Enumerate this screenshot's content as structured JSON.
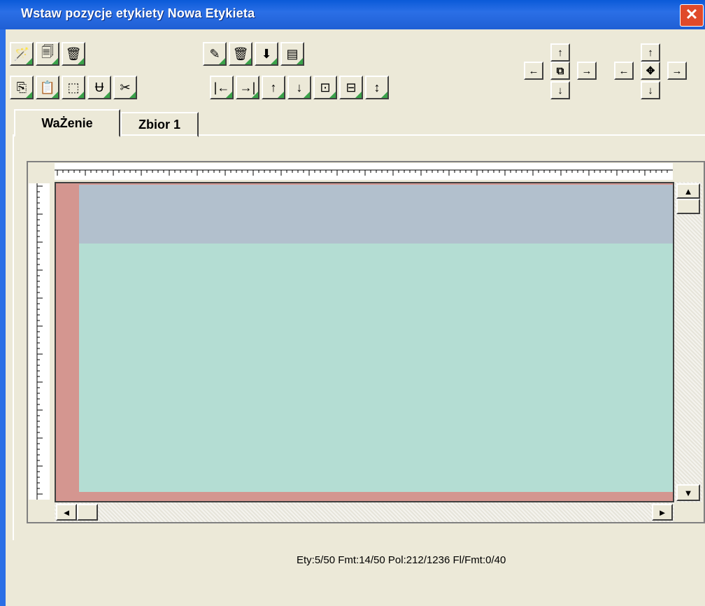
{
  "window": {
    "title": "Wstaw pozycje etykiety Nowa Etykieta",
    "close_glyph": "✕"
  },
  "toolbar": {
    "row1_left": [
      {
        "name": "wand-icon",
        "glyph": "🪄"
      },
      {
        "name": "copy-doc-icon",
        "glyph": "🗐"
      },
      {
        "name": "trash-icon",
        "glyph": "🗑"
      }
    ],
    "row1_mid": [
      {
        "name": "pencil-icon",
        "glyph": "✎"
      },
      {
        "name": "trash-icon",
        "glyph": "🗑"
      },
      {
        "name": "arrow-down-icon",
        "glyph": "⬇"
      },
      {
        "name": "form-icon",
        "glyph": "▤"
      }
    ],
    "row2_left": [
      {
        "name": "copy-icon",
        "glyph": "⎘"
      },
      {
        "name": "paste-icon",
        "glyph": "📋"
      },
      {
        "name": "select-rect-icon",
        "glyph": "⬚"
      },
      {
        "name": "text-field-icon",
        "glyph": "Ʉ"
      },
      {
        "name": "scissors-icon",
        "glyph": "✂"
      }
    ],
    "row2_mid": [
      {
        "name": "align-left-icon",
        "glyph": "|←"
      },
      {
        "name": "align-right-icon",
        "glyph": "→|"
      },
      {
        "name": "align-top-icon",
        "glyph": "↑"
      },
      {
        "name": "align-bottom-icon",
        "glyph": "↓"
      },
      {
        "name": "center-horizontal-icon",
        "glyph": "⊡"
      },
      {
        "name": "center-vertical-icon",
        "glyph": "⊟"
      },
      {
        "name": "distribute-vertical-icon",
        "glyph": "↕"
      }
    ]
  },
  "arrows": {
    "up": "↑",
    "down": "↓",
    "left": "←",
    "right": "→",
    "move_center": "⧉",
    "resize_center": "✥"
  },
  "tabs": [
    {
      "label": "WaŻenie",
      "active": true
    },
    {
      "label": "Zbior 1",
      "active": false
    }
  ],
  "scroll": {
    "up": "▲",
    "down": "▼",
    "left": "◄",
    "right": "►"
  },
  "status": "Ety:5/50 Fmt:14/50 Pol:212/1236 Fl/Fmt:0/40",
  "colors": {
    "title_bar": "#2b6fe6",
    "band_top": "#b2c0cd",
    "band_main": "#b4ddd3",
    "margin": "#d49690"
  }
}
